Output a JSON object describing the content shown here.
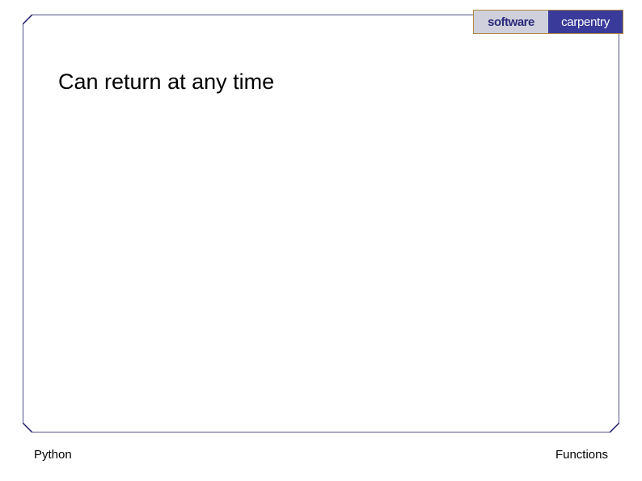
{
  "logo": {
    "left_text": "software",
    "right_text": "carpentry"
  },
  "heading": "Can return at any time",
  "footer": {
    "left": "Python",
    "right": "Functions"
  }
}
